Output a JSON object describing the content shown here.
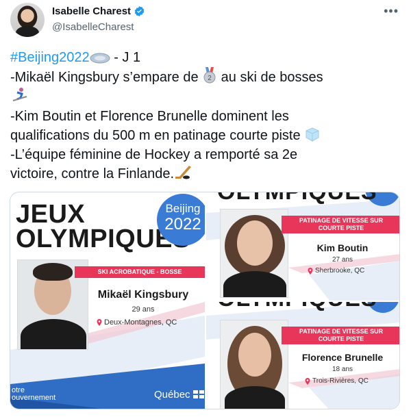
{
  "author": {
    "display_name": "Isabelle Charest",
    "handle": "@IsabelleCharest",
    "verified": true
  },
  "menu_icon": "more-horizontal-icon",
  "tweet": {
    "line1_hashtag": "#Beijing2022",
    "line1_rest": " - J 1",
    "line2_a": " -Mikaël Kingsbury s’empare de ",
    "line2_b": " au ski de bosses",
    "line4": "-Kim Boutin et Florence Brunelle dominent les",
    "line5": "qualifications du 500 m en patinage courte piste ",
    "line6": "-L’équipe féminine de Hockey a remporté sa 2e",
    "line7": "victoire, contre la Finlande.",
    "emojis": [
      "ice-rink-icon",
      "silver-medal-icon",
      "skier-icon",
      "ice-cube-icon",
      "hockey-icon"
    ]
  },
  "media": {
    "left": {
      "header_line1": "JEUX",
      "header_line2": "OLYMPIQUES",
      "badge_line1": "Beijing",
      "badge_line2": "2022",
      "category": "SKI ACROBATIQUE - BOSSE",
      "athlete": "Mikaël Kingsbury",
      "age": "29 ans",
      "town": "Deux-Montagnes, QC",
      "gov_line1": "otre",
      "gov_line2": "ouvernement",
      "quebec": "Québec"
    },
    "right_top": {
      "top_cut_text": "OLYMPIQUES",
      "category_line1": "PATINAGE DE VITESSE SUR",
      "category_line2": "COURTE PISTE",
      "athlete": "Kim Boutin",
      "age": "27 ans",
      "town": "Sherbrooke, QC"
    },
    "right_bottom": {
      "top_cut_text": "OLYMPIQUES",
      "category_line1": "PATINAGE DE VITESSE SUR",
      "category_line2": "COURTE PISTE",
      "athlete": "Florence Brunelle",
      "age": "18 ans",
      "town": "Trois-Rivières, QC"
    }
  },
  "colors": {
    "link": "#1d9bf0",
    "accent_red": "#e8365a",
    "olympic_blue": "#3a7bd5",
    "border": "#cfd9de"
  }
}
